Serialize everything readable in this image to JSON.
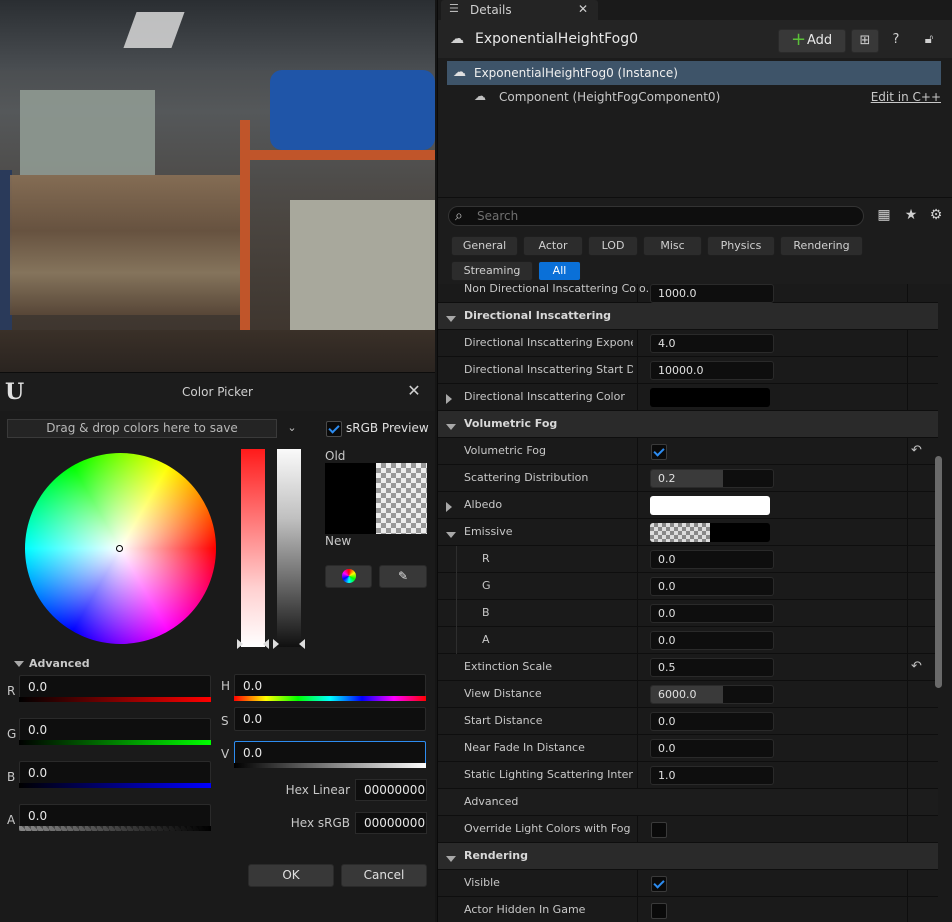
{
  "color_picker": {
    "title": "Color Picker",
    "dropzone_text": "Drag & drop colors here to save",
    "srgb_preview_label": "sRGB Preview",
    "srgb_preview_checked": true,
    "old_label": "Old",
    "new_label": "New",
    "advanced_label": "Advanced",
    "channels": {
      "R": "0.0",
      "G": "0.0",
      "B": "0.0",
      "A": "0.0",
      "H": "0.0",
      "S": "0.0",
      "V": "0.0"
    },
    "channel_labels": {
      "R": "R",
      "G": "G",
      "B": "B",
      "A": "A",
      "H": "H",
      "S": "S",
      "V": "V"
    },
    "hex_linear_label": "Hex Linear",
    "hex_linear_value": "00000000",
    "hex_srgb_label": "Hex sRGB",
    "hex_srgb_value": "00000000",
    "ok_label": "OK",
    "cancel_label": "Cancel"
  },
  "details": {
    "tab_label": "Details",
    "actor_name": "ExponentialHeightFog0",
    "add_label": "Add",
    "tree": {
      "root": "ExponentialHeightFog0 (Instance)",
      "child": "Component (HeightFogComponent0)",
      "edit_link": "Edit in C++"
    },
    "search_placeholder": "Search",
    "filters": [
      "General",
      "Actor",
      "LOD",
      "Misc",
      "Physics",
      "Rendering",
      "Streaming",
      "All"
    ],
    "active_filter": "All",
    "partial_row": "Non Directional Inscattering Colo...",
    "partial_row_value": "1000.0",
    "rows": [
      {
        "type": "cat",
        "name": "Directional Inscattering"
      },
      {
        "type": "num",
        "name": "Directional Inscattering Exponent",
        "value": "4.0"
      },
      {
        "type": "num",
        "name": "Directional Inscattering Start Dis...",
        "value": "10000.0"
      },
      {
        "type": "color",
        "name": "Directional Inscattering Color",
        "swatch": "#000000",
        "expandable": true
      },
      {
        "type": "cat",
        "name": "Volumetric Fog"
      },
      {
        "type": "check",
        "name": "Volumetric Fog",
        "checked": true,
        "reset": true
      },
      {
        "type": "num",
        "name": "Scattering Distribution",
        "value": "0.2",
        "fill": 0.2
      },
      {
        "type": "color",
        "name": "Albedo",
        "swatch": "#ffffff",
        "expandable": true
      },
      {
        "type": "color",
        "name": "Emissive",
        "swatch": "checker-black",
        "expanded": true
      },
      {
        "type": "subnum",
        "name": "R",
        "value": "0.0"
      },
      {
        "type": "subnum",
        "name": "G",
        "value": "0.0"
      },
      {
        "type": "subnum",
        "name": "B",
        "value": "0.0"
      },
      {
        "type": "subnum",
        "name": "A",
        "value": "0.0"
      },
      {
        "type": "num",
        "name": "Extinction Scale",
        "value": "0.5",
        "reset": true
      },
      {
        "type": "num",
        "name": "View Distance",
        "value": "6000.0",
        "fill": 0.5
      },
      {
        "type": "num",
        "name": "Start Distance",
        "value": "0.0"
      },
      {
        "type": "num",
        "name": "Near Fade In Distance",
        "value": "0.0"
      },
      {
        "type": "num",
        "name": "Static Lighting Scattering Intensi...",
        "value": "1.0"
      },
      {
        "type": "subcat",
        "name": "Advanced"
      },
      {
        "type": "check",
        "name": "Override Light Colors with Fog In...",
        "checked": false
      },
      {
        "type": "cat",
        "name": "Rendering"
      },
      {
        "type": "check",
        "name": "Visible",
        "checked": true
      },
      {
        "type": "check",
        "name": "Actor Hidden In Game",
        "checked": false
      }
    ]
  },
  "colors": {
    "accent": "#0a70d8",
    "selection": "#3e5469",
    "check": "#2d8cf0",
    "add_plus": "#5ac038"
  }
}
